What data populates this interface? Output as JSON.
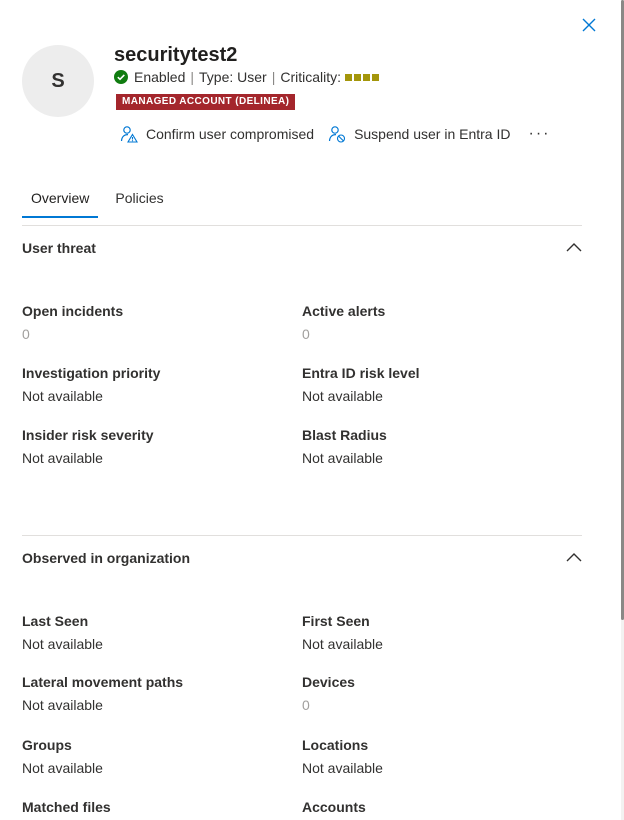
{
  "user": {
    "initial": "S",
    "name": "securitytest2",
    "status": "Enabled",
    "type": "Type: User",
    "criticality": "Criticality:",
    "badge": "MANAGED ACCOUNT (DELINEA)"
  },
  "actions": {
    "confirm": "Confirm user compromised",
    "suspend": "Suspend user in Entra ID",
    "more": "···"
  },
  "tabs": [
    "Overview",
    "Policies"
  ],
  "sections": {
    "threat": {
      "title": "User threat",
      "fields": [
        {
          "label": "Open incidents",
          "value": "0"
        },
        {
          "label": "Active alerts",
          "value": "0"
        },
        {
          "label": "Investigation priority",
          "value": "Not available"
        },
        {
          "label": "Entra ID risk level",
          "value": "Not available"
        },
        {
          "label": "Insider risk severity",
          "value": "Not available"
        },
        {
          "label": "Blast Radius",
          "value": "Not available"
        }
      ]
    },
    "observed": {
      "title": "Observed in organization",
      "fields": [
        {
          "label": "Last Seen",
          "value": "Not available"
        },
        {
          "label": "First Seen",
          "value": "Not available"
        },
        {
          "label": "Lateral movement paths",
          "value": "Not available"
        },
        {
          "label": "Devices",
          "value": "0"
        },
        {
          "label": "Groups",
          "value": "Not available"
        },
        {
          "label": "Locations",
          "value": "Not available"
        },
        {
          "label": "Matched files",
          "value": ""
        },
        {
          "label": "Accounts",
          "value": ""
        }
      ]
    }
  },
  "colors": {
    "accent": "#0078d4",
    "badge_bg": "#a4262c",
    "status_ok": "#107c10",
    "criticality": "#a4960b"
  }
}
